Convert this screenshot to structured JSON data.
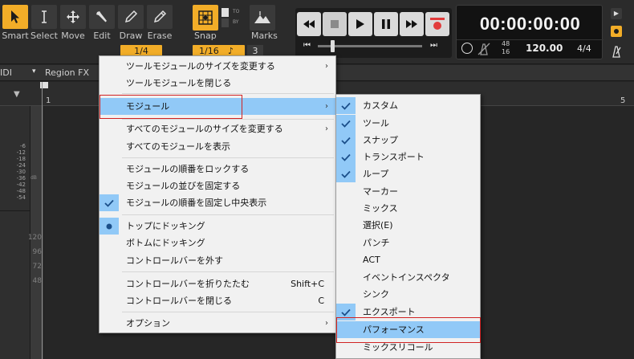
{
  "tools": [
    {
      "label": "Smart",
      "icon": "cursor-arrow-icon",
      "active": true
    },
    {
      "label": "Select",
      "icon": "text-cursor-icon",
      "active": false
    },
    {
      "label": "Move",
      "icon": "move-arrows-icon",
      "active": false
    },
    {
      "label": "Edit",
      "icon": "wrench-icon",
      "active": false
    },
    {
      "label": "Draw",
      "icon": "pencil-icon",
      "active": false
    },
    {
      "label": "Erase",
      "icon": "eraser-icon",
      "active": false
    }
  ],
  "draw_value": "1/4",
  "snap": {
    "label": "Snap",
    "value": "1/16",
    "to": "TO",
    "by": "BY",
    "count": "3"
  },
  "marks_label": "Marks",
  "time": "00:00:00:00",
  "sample_rate_top": "48",
  "sample_rate_bottom": "16",
  "tempo": "120.00",
  "meter": "4/4",
  "row2": {
    "left": "IDI",
    "middle": "Region FX"
  },
  "ruler": {
    "start": "1",
    "end": "5"
  },
  "meter_scale": [
    "-6",
    "-12",
    "-18",
    "-24",
    "-30",
    "-36",
    "-42",
    "-48",
    "-54"
  ],
  "meter_db": "dB",
  "velocity_scale": [
    "120",
    "96",
    "72",
    "48"
  ],
  "main_menu": [
    {
      "label": "ツールモジュールのサイズを変更する",
      "arrow": "›"
    },
    {
      "label": "ツールモジュールを閉じる"
    },
    {
      "label": "モジュール",
      "arrow": "›"
    },
    {
      "label": "すべてのモジュールのサイズを変更する",
      "arrow": "›"
    },
    {
      "label": "すべてのモジュールを表示"
    },
    {
      "label": "モジュールの順番をロックする"
    },
    {
      "label": "モジュールの並びを固定する"
    },
    {
      "label": "モジュールの順番を固定し中央表示"
    },
    {
      "label": "トップにドッキング"
    },
    {
      "label": "ボトムにドッキング"
    },
    {
      "label": "コントロールバーを外す"
    },
    {
      "label": "コントロールバーを折りたたむ",
      "shortcut": "Shift+C"
    },
    {
      "label": "コントロールバーを閉じる",
      "shortcut": "C"
    },
    {
      "label": "オプション",
      "arrow": "›"
    }
  ],
  "sub_menu": [
    {
      "label": "カスタム"
    },
    {
      "label": "ツール"
    },
    {
      "label": "スナップ"
    },
    {
      "label": "トランスポート"
    },
    {
      "label": "ループ"
    },
    {
      "label": "マーカー"
    },
    {
      "label": "ミックス"
    },
    {
      "label": "選択(E)"
    },
    {
      "label": "パンチ"
    },
    {
      "label": "ACT"
    },
    {
      "label": "イベントインスペクタ"
    },
    {
      "label": "シンク"
    },
    {
      "label": "エクスポート"
    },
    {
      "label": "パフォーマンス"
    },
    {
      "label": "ミックスリコール"
    }
  ],
  "colors": {
    "accent": "#f2ad28",
    "highlight": "#91c9f7",
    "record": "#e23b3b",
    "redbox": "#d12323"
  }
}
